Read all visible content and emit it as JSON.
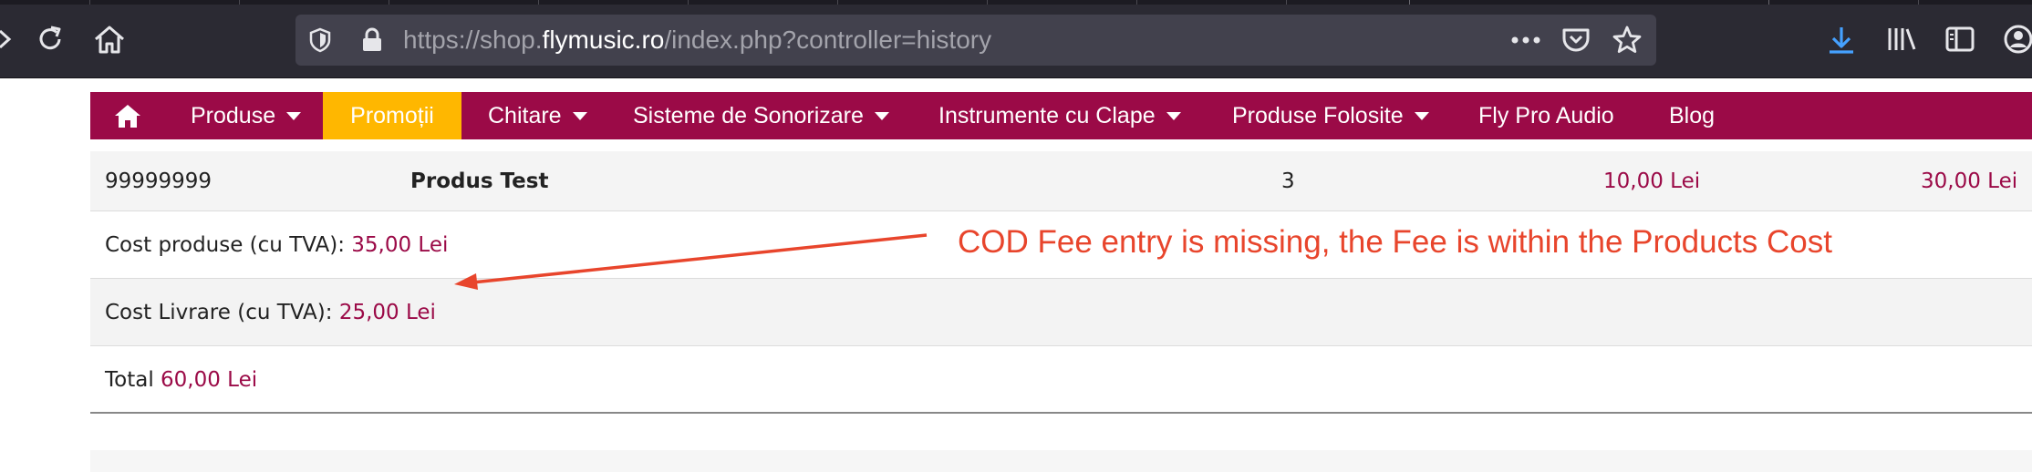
{
  "browser": {
    "url_prefix": "https://shop.",
    "url_host": "flymusic.ro",
    "url_path": "/index.php?controller=history",
    "icons": [
      "forward-icon",
      "reload-icon",
      "home-icon",
      "tracking-shield-icon",
      "lock-icon",
      "page-actions-icon",
      "pocket-icon",
      "bookmark-star-icon",
      "downloads-icon",
      "library-icon",
      "sidebar-icon",
      "account-icon"
    ],
    "accent_download": "#45a1ff"
  },
  "navbar": {
    "background": "#9b0a47",
    "highlight": "#ffb700",
    "items": [
      {
        "label": "Produse"
      },
      {
        "label": "Promoții"
      },
      {
        "label": "Chitare"
      },
      {
        "label": "Sisteme de Sonorizare"
      },
      {
        "label": "Instrumente cu Clape"
      },
      {
        "label": "Produse Folosite"
      },
      {
        "label": "Fly Pro Audio"
      },
      {
        "label": "Blog"
      }
    ]
  },
  "order": {
    "product": {
      "reference": "99999999",
      "name": "Produs Test",
      "quantity": "3",
      "unit_price": "10,00 Lei",
      "total_price": "30,00 Lei"
    },
    "products_cost": {
      "label": "Cost produse (cu TVA):",
      "value": "35,00 Lei"
    },
    "shipping_cost": {
      "label": "Cost Livrare (cu TVA):",
      "value": "25,00 Lei"
    },
    "total": {
      "label": "Total",
      "value": "60,00 Lei"
    }
  },
  "annotation": {
    "text": "COD Fee entry is missing, the Fee is within the Products Cost",
    "color": "#e8452c"
  }
}
